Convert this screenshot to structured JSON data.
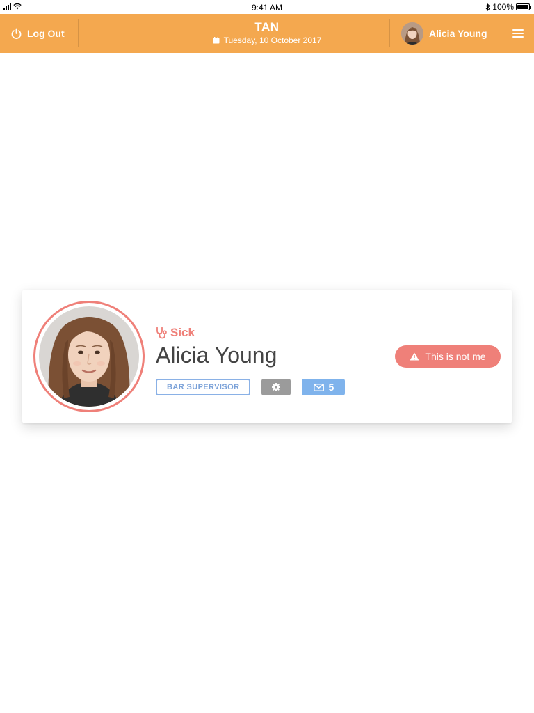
{
  "status_bar": {
    "time": "9:41 AM",
    "battery": "100%",
    "battery_level": 1.0,
    "icons": [
      "signal-icon",
      "wifi-icon",
      "bluetooth-icon",
      "battery-icon"
    ]
  },
  "header": {
    "logout_label": "Log Out",
    "title": "TAN",
    "date": "Tuesday, 10 October 2017",
    "user_name": "Alicia Young",
    "icons": [
      "power-icon",
      "calendar-icon",
      "avatar",
      "hamburger-menu-icon"
    ]
  },
  "profile": {
    "status": "Sick",
    "name": "Alicia Young",
    "role": "BAR SUPERVISOR",
    "message_count": "5",
    "not_me_label": "This is not me",
    "icons": [
      "stethoscope-icon",
      "gear-icon",
      "envelope-icon",
      "warning-icon"
    ]
  },
  "colors": {
    "header_bg": "#f4a84f",
    "accent_red": "#ef8079",
    "role_blue": "#7aa1d8",
    "message_blue": "#7fb3ec",
    "settings_gray": "#9b9b9b"
  }
}
